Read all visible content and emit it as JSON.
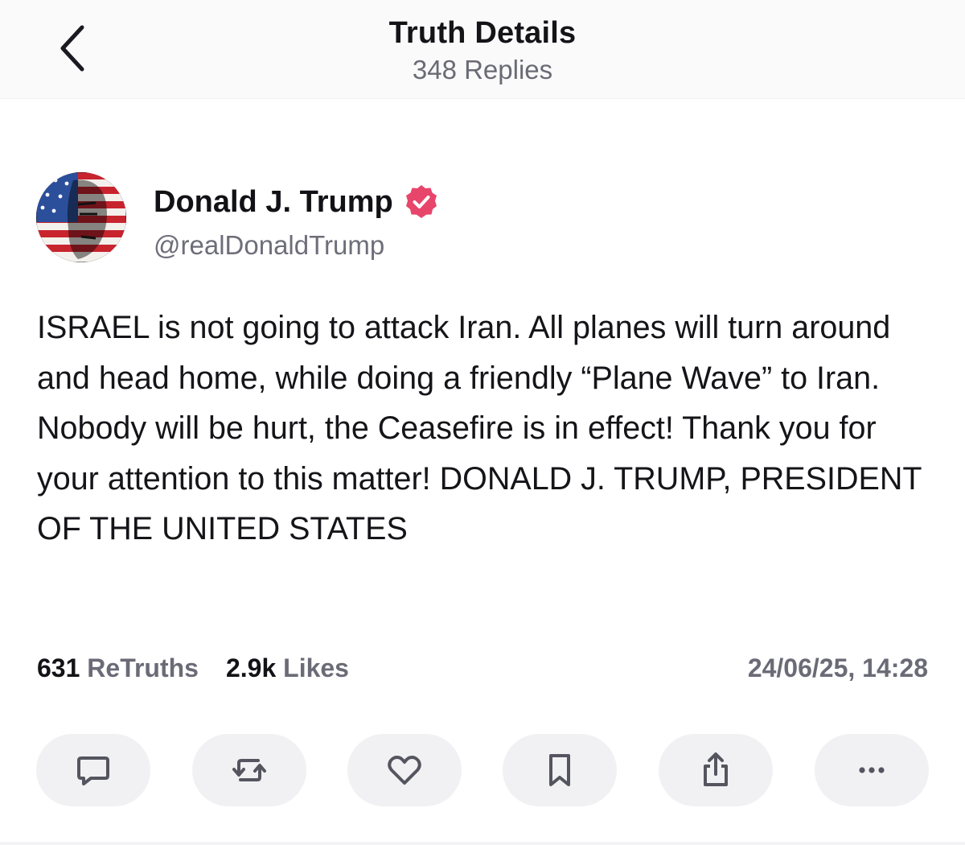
{
  "header": {
    "title": "Truth Details",
    "subtitle": "348 Replies",
    "back_icon": "chevron-left-icon"
  },
  "author": {
    "name": "Donald J. Trump",
    "handle": "@realDonaldTrump",
    "verified_icon": "verified-badge-icon",
    "verified_color": "#e8456b"
  },
  "post": {
    "text": "ISRAEL is not going to attack Iran. All planes will turn around and head home, while doing a friendly “Plane Wave” to Iran. Nobody will be hurt, the Ceasefire is in effect! Thank you for your attention to this matter! DONALD J. TRUMP, PRESIDENT OF THE UNITED STATES"
  },
  "stats": {
    "retruths_count": "631",
    "retruths_label": "ReTruths",
    "likes_count": "2.9k",
    "likes_label": "Likes",
    "timestamp": "24/06/25, 14:28"
  },
  "actions": [
    {
      "icon": "reply-icon"
    },
    {
      "icon": "retruth-icon"
    },
    {
      "icon": "like-icon"
    },
    {
      "icon": "bookmark-icon"
    },
    {
      "icon": "share-icon"
    },
    {
      "icon": "more-icon"
    }
  ],
  "colors": {
    "accent": "#e8456b",
    "muted_text": "#6b6b77",
    "button_bg": "#f1f1f4"
  }
}
